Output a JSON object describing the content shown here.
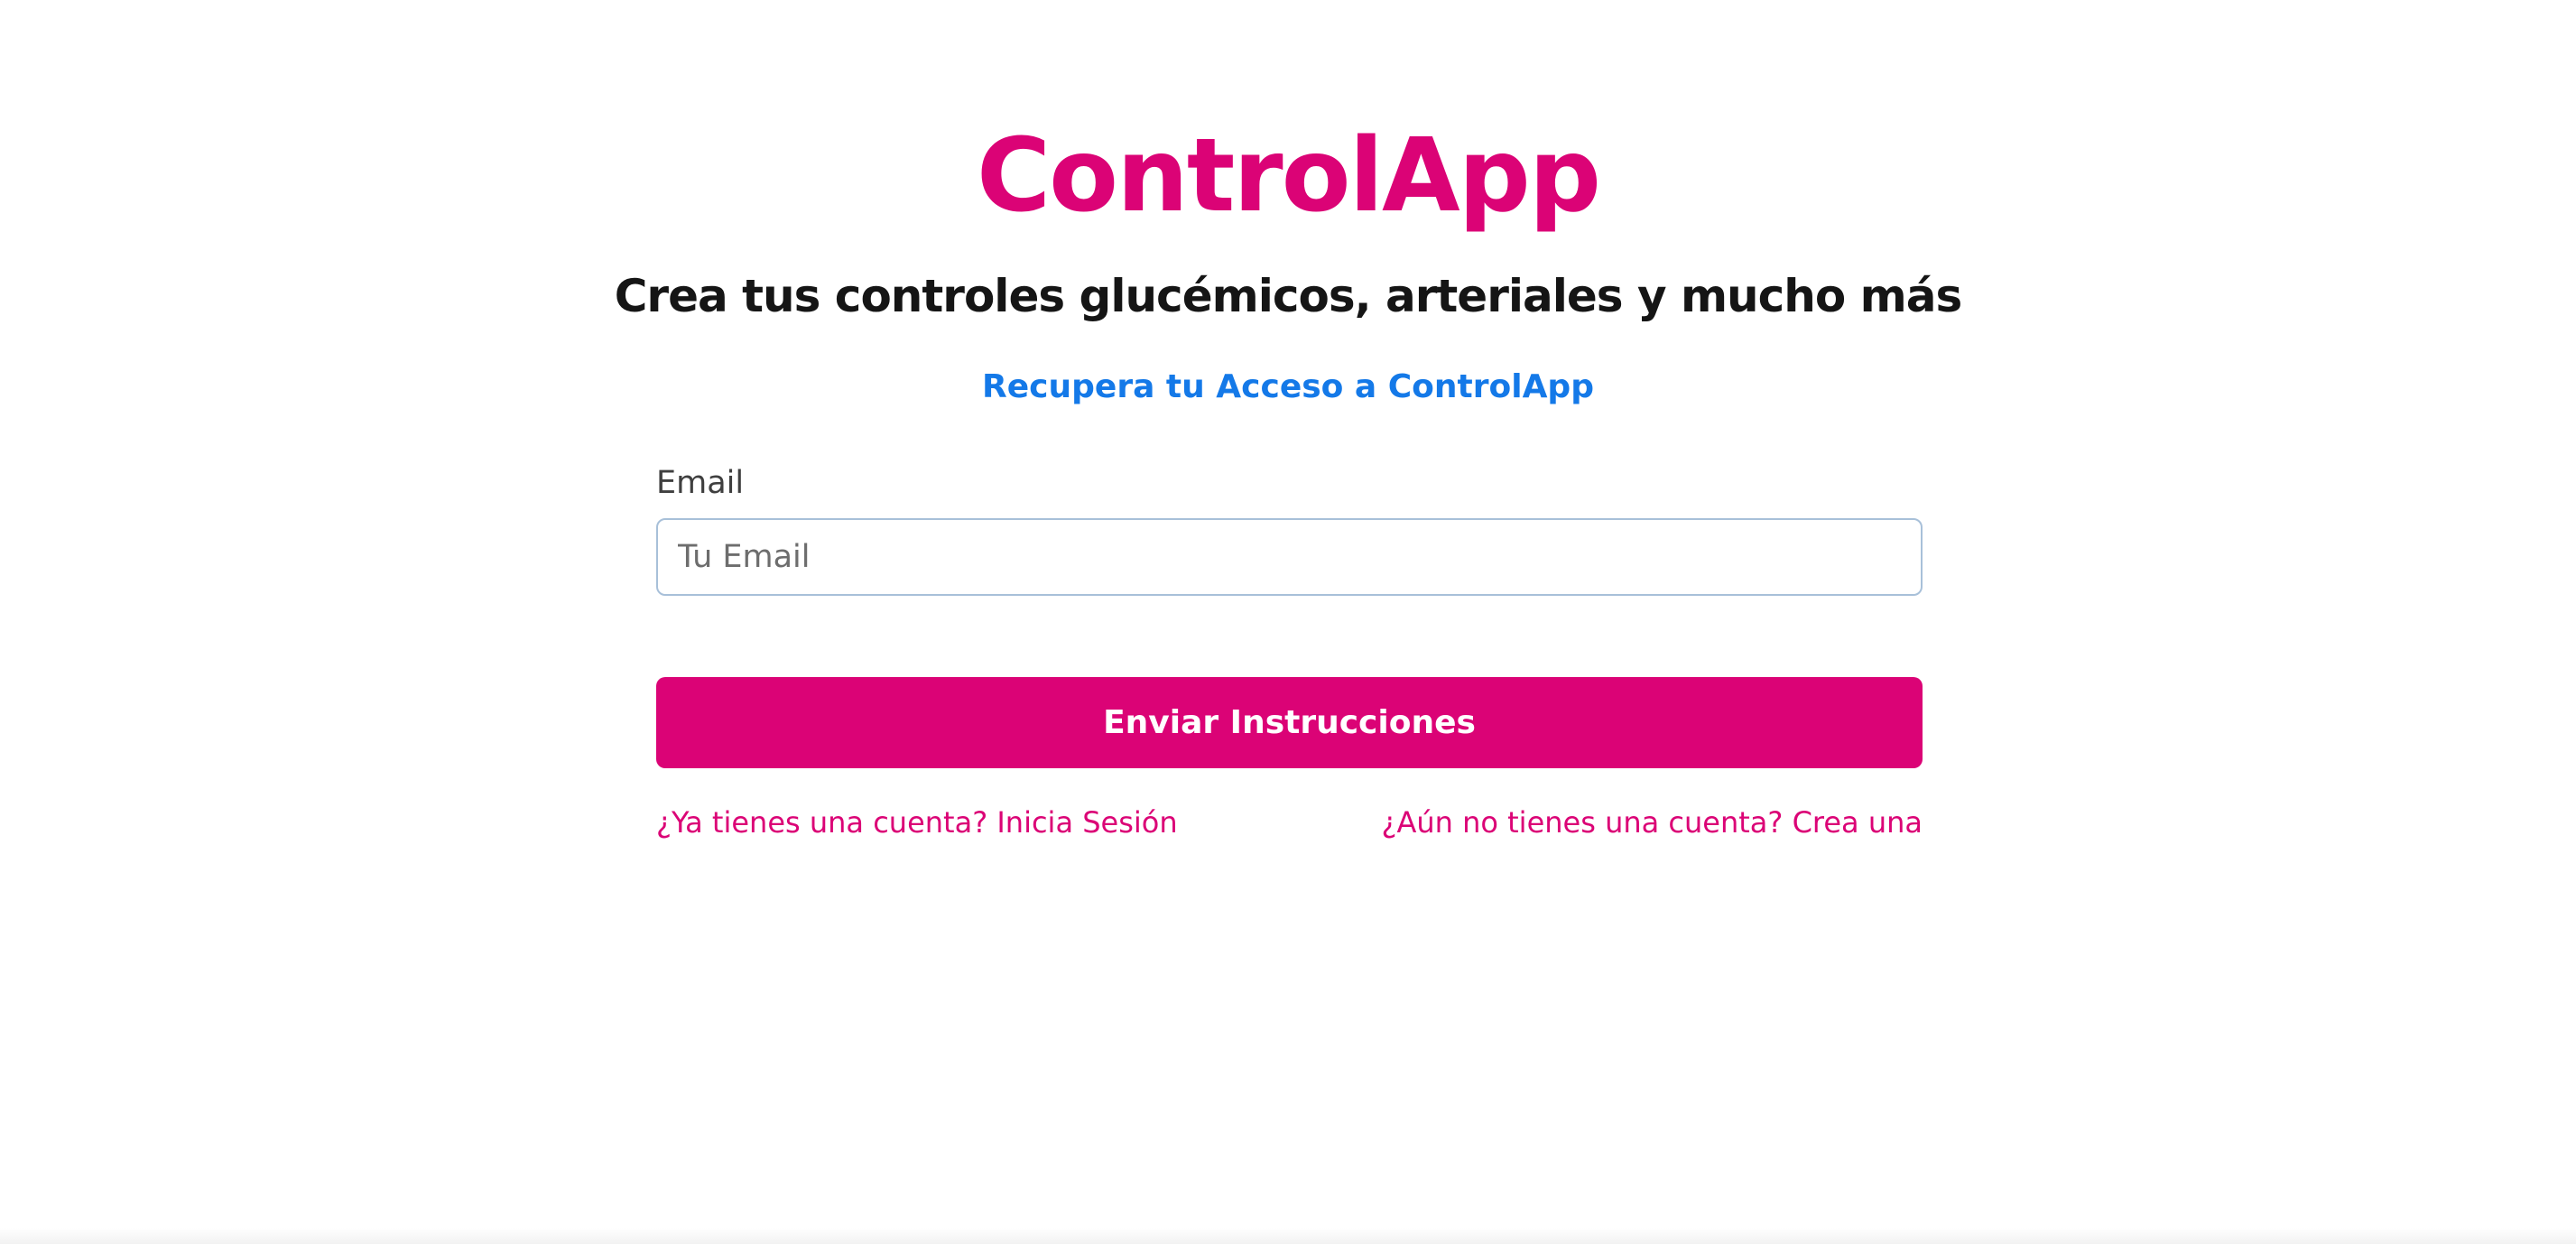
{
  "header": {
    "brand": "ControlApp",
    "tagline": "Crea tus controles glucémicos, arteriales y mucho más",
    "subtitle_link": "Recupera tu Acceso a ControlApp"
  },
  "form": {
    "email_label": "Email",
    "email_placeholder": "Tu Email",
    "email_value": "",
    "submit_label": "Enviar Instrucciones"
  },
  "footer_links": {
    "login": "¿Ya tienes una cuenta? Inicia Sesión",
    "register": "¿Aún no tienes una cuenta? Crea una"
  },
  "colors": {
    "brand": "#db0376",
    "link_blue": "#1479e8",
    "heading": "#151515"
  }
}
